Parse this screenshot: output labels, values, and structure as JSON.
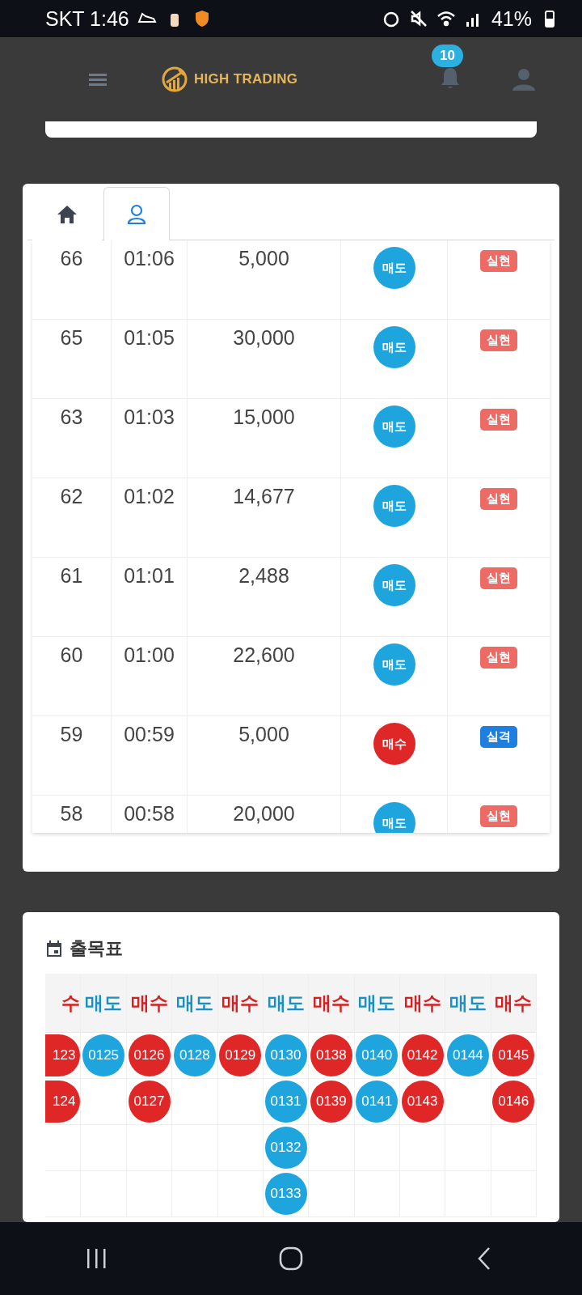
{
  "status_bar": {
    "carrier_time": "SKT 1:46",
    "battery": "41%"
  },
  "header": {
    "brand": "HIGH TRADING",
    "notification_count": "10"
  },
  "tabs": [
    {
      "kind": "home",
      "selected": false
    },
    {
      "kind": "user",
      "selected": true
    }
  ],
  "trades": [
    {
      "no": "66",
      "time": "01:06",
      "amount": "5,000",
      "side": {
        "kind": "sell",
        "label": "매도"
      },
      "result": {
        "kind": "realized",
        "label": "실현"
      }
    },
    {
      "no": "65",
      "time": "01:05",
      "amount": "30,000",
      "side": {
        "kind": "sell",
        "label": "매도"
      },
      "result": {
        "kind": "realized",
        "label": "실현"
      }
    },
    {
      "no": "63",
      "time": "01:03",
      "amount": "15,000",
      "side": {
        "kind": "sell",
        "label": "매도"
      },
      "result": {
        "kind": "realized",
        "label": "실현"
      }
    },
    {
      "no": "62",
      "time": "01:02",
      "amount": "14,677",
      "side": {
        "kind": "sell",
        "label": "매도"
      },
      "result": {
        "kind": "realized",
        "label": "실현"
      }
    },
    {
      "no": "61",
      "time": "01:01",
      "amount": "2,488",
      "side": {
        "kind": "sell",
        "label": "매도"
      },
      "result": {
        "kind": "realized",
        "label": "실현"
      }
    },
    {
      "no": "60",
      "time": "01:00",
      "amount": "22,600",
      "side": {
        "kind": "sell",
        "label": "매도"
      },
      "result": {
        "kind": "realized",
        "label": "실현"
      }
    },
    {
      "no": "59",
      "time": "00:59",
      "amount": "5,000",
      "side": {
        "kind": "buy",
        "label": "매수"
      },
      "result": {
        "kind": "failed",
        "label": "실격"
      }
    },
    {
      "no": "58",
      "time": "00:58",
      "amount": "20,000",
      "side": {
        "kind": "sell",
        "label": "매도"
      },
      "result": {
        "kind": "realized",
        "label": "실현"
      }
    }
  ],
  "chart": {
    "title": "출목표",
    "columns": [
      {
        "kind": "buy",
        "clipped": true,
        "label": "수",
        "items": [
          "123",
          "124"
        ]
      },
      {
        "kind": "sell",
        "clipped": false,
        "label": "매도",
        "items": [
          "0125"
        ]
      },
      {
        "kind": "buy",
        "clipped": false,
        "label": "매수",
        "items": [
          "0126",
          "0127"
        ]
      },
      {
        "kind": "sell",
        "clipped": false,
        "label": "매도",
        "items": [
          "0128"
        ]
      },
      {
        "kind": "buy",
        "clipped": false,
        "label": "매수",
        "items": [
          "0129"
        ]
      },
      {
        "kind": "sell",
        "clipped": false,
        "label": "매도",
        "items": [
          "0130",
          "0131",
          "0132",
          "0133"
        ]
      },
      {
        "kind": "buy",
        "clipped": false,
        "label": "매수",
        "items": [
          "0138",
          "0139"
        ]
      },
      {
        "kind": "sell",
        "clipped": false,
        "label": "매도",
        "items": [
          "0140",
          "0141"
        ]
      },
      {
        "kind": "buy",
        "clipped": false,
        "label": "매수",
        "items": [
          "0142",
          "0143"
        ]
      },
      {
        "kind": "sell",
        "clipped": false,
        "label": "매도",
        "items": [
          "0144"
        ]
      },
      {
        "kind": "buy",
        "clipped": false,
        "label": "매수",
        "items": [
          "0145",
          "0146"
        ]
      }
    ]
  }
}
